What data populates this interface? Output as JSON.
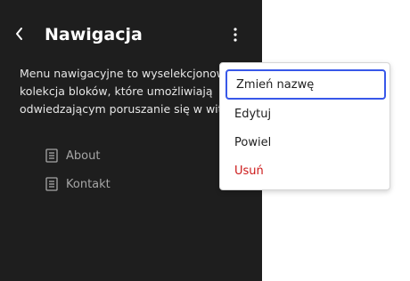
{
  "header": {
    "title": "Nawigacja"
  },
  "description": {
    "lines": [
      "Menu nawigacyjne to wyselekcjonowana",
      "kolekcja bloków, które umożliwiają",
      "odwiedzającym poruszanie się w witrynie."
    ]
  },
  "nav_items": [
    {
      "label": "About",
      "icon": "page-icon"
    },
    {
      "label": "Kontakt",
      "icon": "page-icon"
    }
  ],
  "dropdown": {
    "items": [
      {
        "label": "Zmień nazwę"
      },
      {
        "label": "Edytuj"
      },
      {
        "label": "Powiel"
      },
      {
        "label": "Usuń"
      }
    ]
  },
  "colors": {
    "sidebar_bg": "#1e1e1e",
    "accent": "#3858e9",
    "danger": "#cc1818"
  }
}
